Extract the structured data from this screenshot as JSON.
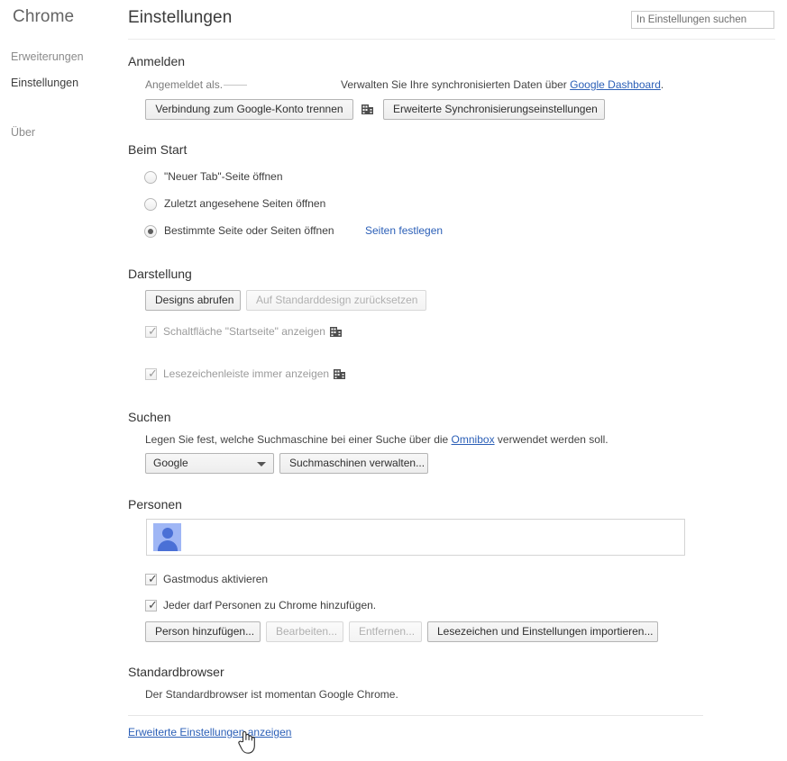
{
  "sidebar": {
    "title": "Chrome",
    "items": [
      {
        "label": "Erweiterungen",
        "selected": false
      },
      {
        "label": "Einstellungen",
        "selected": true
      },
      {
        "label": "Über",
        "selected": false
      }
    ]
  },
  "header": {
    "title": "Einstellungen",
    "search_placeholder": "In Einstellungen suchen",
    "search_value": ""
  },
  "signin": {
    "heading": "Anmelden",
    "signed_in_as": "Angemeldet als.",
    "sync_text_before": "Verwalten Sie Ihre synchronisierten Daten über ",
    "sync_link": "Google Dashboard",
    "sync_text_after": ".",
    "disconnect_button": "Verbindung zum Google-Konto trennen",
    "advanced_sync_button": "Erweiterte Synchronisierungseinstellungen",
    "policy_icon": "enterprise-building-icon"
  },
  "startup": {
    "heading": "Beim Start",
    "options": [
      {
        "label": "\"Neuer Tab\"-Seite öffnen",
        "selected": false
      },
      {
        "label": "Zuletzt angesehene Seiten öffnen",
        "selected": false
      },
      {
        "label": "Bestimmte Seite oder Seiten öffnen",
        "selected": true
      }
    ],
    "set_pages_link": "Seiten festlegen"
  },
  "appearance": {
    "heading": "Darstellung",
    "get_themes_button": "Designs abrufen",
    "reset_theme_button": "Auf Standarddesign zurücksetzen",
    "reset_theme_disabled": true,
    "checkboxes": [
      {
        "label": "Schaltfläche \"Startseite\" anzeigen",
        "checked": true,
        "disabled": true,
        "policy_icon": "enterprise-building-icon"
      },
      {
        "label": "Lesezeichenleiste immer anzeigen",
        "checked": true,
        "disabled": true,
        "policy_icon": "enterprise-building-icon"
      }
    ]
  },
  "search": {
    "heading": "Suchen",
    "description_before": "Legen Sie fest, welche Suchmaschine bei einer Suche über die ",
    "description_link": "Omnibox",
    "description_after": " verwendet werden soll.",
    "engine_selected": "Google",
    "manage_button": "Suchmaschinen verwalten..."
  },
  "people": {
    "heading": "Personen",
    "avatar_icon": "person-avatar-icon",
    "checkboxes": [
      {
        "label": "Gastmodus aktivieren",
        "checked": true,
        "disabled": false
      },
      {
        "label": "Jeder darf Personen zu Chrome hinzufügen.",
        "checked": true,
        "disabled": false
      }
    ],
    "buttons": [
      {
        "label": "Person hinzufügen...",
        "disabled": false
      },
      {
        "label": "Bearbeiten...",
        "disabled": true
      },
      {
        "label": "Entfernen...",
        "disabled": true
      },
      {
        "label": "Lesezeichen und Einstellungen importieren...",
        "disabled": false
      }
    ]
  },
  "default_browser": {
    "heading": "Standardbrowser",
    "status": "Der Standardbrowser ist momentan Google Chrome."
  },
  "footer": {
    "advanced_link": "Erweiterte Einstellungen anzeigen"
  },
  "cursor": {
    "icon": "pointing-hand-cursor"
  },
  "colors": {
    "link": "#2b5fb7",
    "text": "#333333",
    "disabled_text": "#9b9b9b",
    "avatar_bg": "#9fb6f5",
    "avatar_fg": "#4a70d6"
  }
}
